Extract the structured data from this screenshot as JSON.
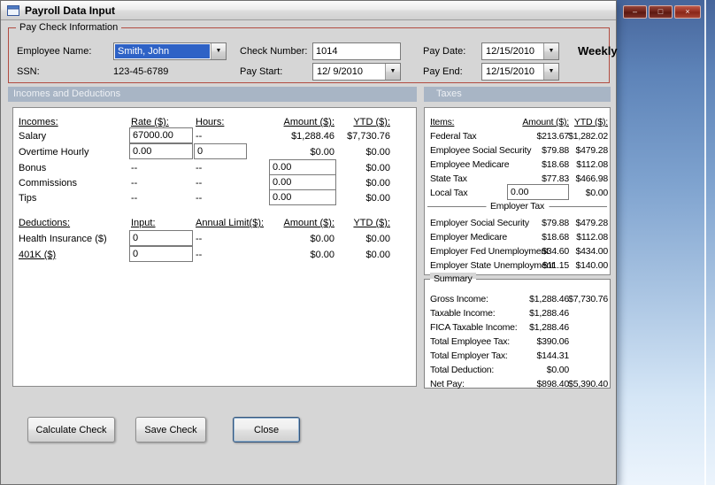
{
  "window": {
    "title": "Payroll Data Input",
    "frequency_label": "Weekly"
  },
  "icons": {
    "dropdown": "▼",
    "minimize": "–",
    "maximize": "□",
    "close": "×"
  },
  "paycheck": {
    "group_title": "Pay Check Information",
    "employee_name_label": "Employee Name:",
    "employee_name_value": "Smith, John",
    "ssn_label": "SSN:",
    "ssn_value": "123-45-6789",
    "check_number_label": "Check Number:",
    "check_number_value": "1014",
    "pay_start_label": "Pay Start:",
    "pay_start_value": "12/ 9/2010",
    "pay_date_label": "Pay Date:",
    "pay_date_value": "12/15/2010",
    "pay_end_label": "Pay End:",
    "pay_end_value": "12/15/2010"
  },
  "section_headers": {
    "incomes": "Incomes and Deductions",
    "taxes": "Taxes"
  },
  "incomes_table": {
    "headers": {
      "name": "Incomes:",
      "rate": "Rate ($):",
      "hours": "Hours:",
      "amount": "Amount ($):",
      "ytd": "YTD ($):"
    },
    "rows": [
      {
        "name": "Salary",
        "rate": "67000.00",
        "hours": "--",
        "amount": "$1,288.46",
        "ytd": "$7,730.76"
      },
      {
        "name": "Overtime Hourly",
        "rate": "0.00",
        "hours": "0",
        "amount": "$0.00",
        "ytd": "$0.00"
      },
      {
        "name": "Bonus",
        "rate": "--",
        "hours": "--",
        "amount": "0.00",
        "ytd": "$0.00"
      },
      {
        "name": "Commissions",
        "rate": "--",
        "hours": "--",
        "amount": "0.00",
        "ytd": "$0.00"
      },
      {
        "name": "Tips",
        "rate": "--",
        "hours": "--",
        "amount": "0.00",
        "ytd": "$0.00"
      }
    ]
  },
  "deductions_table": {
    "headers": {
      "name": "Deductions:",
      "input": "Input:",
      "limit": "Annual Limit($):",
      "amount": "Amount ($):",
      "ytd": "YTD ($):"
    },
    "rows": [
      {
        "name": "Health Insurance ($)",
        "input": "0",
        "limit": "--",
        "amount": "$0.00",
        "ytd": "$0.00"
      },
      {
        "name": "401K ($)",
        "input": "0",
        "limit": "--",
        "amount": "$0.00",
        "ytd": "$0.00"
      }
    ]
  },
  "taxes_table": {
    "headers": {
      "items": "Items:",
      "amount": "Amount ($):",
      "ytd": "YTD ($):"
    },
    "employee_rows": [
      {
        "name": "Federal Tax",
        "amount": "$213.67",
        "ytd": "$1,282.02"
      },
      {
        "name": "Employee Social Security",
        "amount": "$79.88",
        "ytd": "$479.28"
      },
      {
        "name": "Employee Medicare",
        "amount": "$18.68",
        "ytd": "$112.08"
      },
      {
        "name": "State Tax",
        "amount": "$77.83",
        "ytd": "$466.98"
      },
      {
        "name": "Local Tax",
        "amount": "0.00",
        "ytd": "$0.00"
      }
    ],
    "employer_divider": "Employer Tax",
    "employer_rows": [
      {
        "name": "Employer Social Security",
        "amount": "$79.88",
        "ytd": "$479.28"
      },
      {
        "name": "Employer Medicare",
        "amount": "$18.68",
        "ytd": "$112.08"
      },
      {
        "name": "Employer Fed Unemployment",
        "amount": "$34.60",
        "ytd": "$434.00"
      },
      {
        "name": "Employer State Unemployment",
        "amount": "$11.15",
        "ytd": "$140.00"
      }
    ]
  },
  "summary": {
    "group_title": "Summary",
    "rows": [
      {
        "name": "Gross Income:",
        "amount": "$1,288.46",
        "ytd": "$7,730.76"
      },
      {
        "name": "Taxable Income:",
        "amount": "$1,288.46",
        "ytd": ""
      },
      {
        "name": "FICA Taxable Income:",
        "amount": "$1,288.46",
        "ytd": ""
      },
      {
        "name": "Total Employee Tax:",
        "amount": "$390.06",
        "ytd": ""
      },
      {
        "name": "Total Employer Tax:",
        "amount": "$144.31",
        "ytd": ""
      },
      {
        "name": "Total Deduction:",
        "amount": "$0.00",
        "ytd": ""
      },
      {
        "name": "Net Pay:",
        "amount": "$898.40",
        "ytd": "$5,390.40"
      }
    ]
  },
  "buttons": {
    "calculate": "Calculate Check",
    "save": "Save Check",
    "close": "Close"
  }
}
